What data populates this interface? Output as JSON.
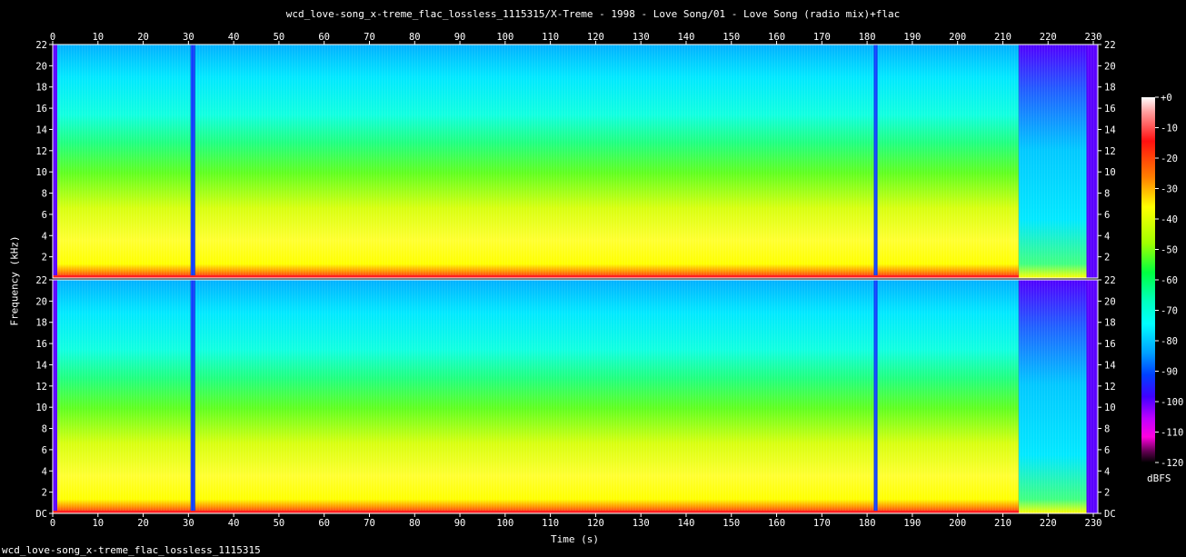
{
  "title": "wcd_love-song_x-treme_flac_lossless_1115315/X-Treme - 1998 - Love Song/01 - Love Song (radio mix)+flac",
  "footer": "wcd_love-song_x-treme_flac_lossless_1115315",
  "chart_data": {
    "type": "heatmap",
    "xlabel": "Time (s)",
    "ylabel": "Frequency (kHz)",
    "xlim": [
      0,
      231
    ],
    "ylim": [
      0,
      22
    ],
    "x_ticks": [
      0,
      10,
      20,
      30,
      40,
      50,
      60,
      70,
      80,
      90,
      100,
      110,
      120,
      130,
      140,
      150,
      160,
      170,
      180,
      190,
      200,
      210,
      220,
      230
    ],
    "y_ticks": [
      "DC",
      "2",
      "4",
      "6",
      "8",
      "10",
      "12",
      "14",
      "16",
      "18",
      "20",
      "22"
    ],
    "channels": 2,
    "colorbar": {
      "unit": "dBFS",
      "ticks": [
        "+0",
        "-10",
        "-20",
        "-30",
        "-40",
        "-50",
        "-60",
        "-70",
        "-80",
        "-90",
        "-100",
        "-110",
        "-120"
      ],
      "range": [
        -120,
        0
      ]
    },
    "segments": [
      {
        "start": 0,
        "end": 1,
        "level_db": -90
      },
      {
        "start": 1,
        "end": 30.5,
        "level_db": -40
      },
      {
        "start": 30.5,
        "end": 31.5,
        "level_db": -85
      },
      {
        "start": 31.5,
        "end": 181.5,
        "level_db": -38
      },
      {
        "start": 181.5,
        "end": 182.3,
        "level_db": -85
      },
      {
        "start": 182.3,
        "end": 213.5,
        "level_db": -40
      },
      {
        "start": 213.5,
        "end": 228.5,
        "level_db": -70
      },
      {
        "start": 228.5,
        "end": 231,
        "level_db": -95
      }
    ]
  }
}
